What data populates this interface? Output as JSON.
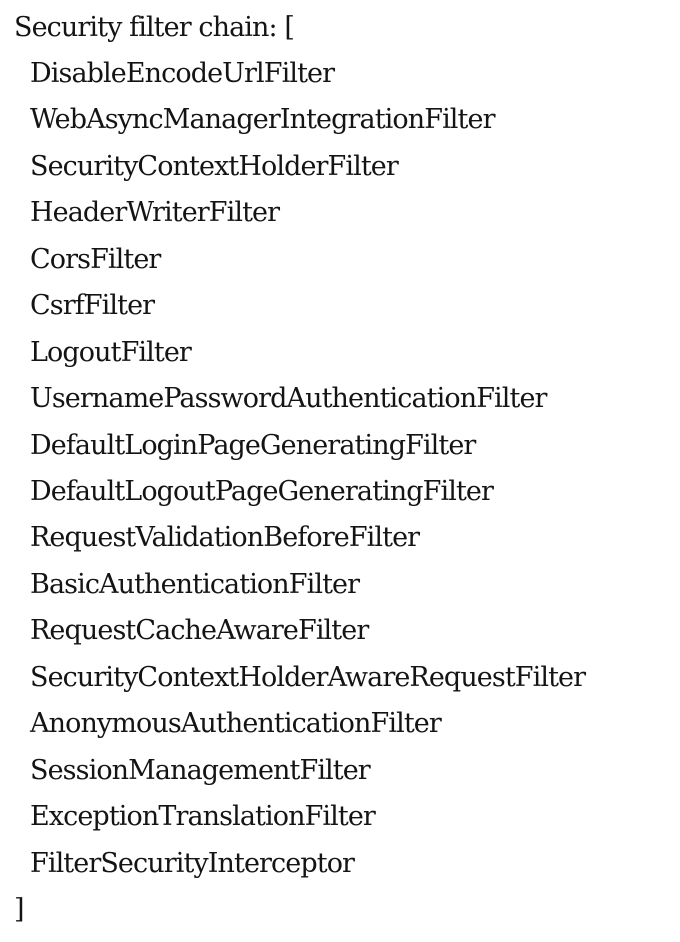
{
  "heading": "Security filter chain: [",
  "filters": [
    "DisableEncodeUrlFilter",
    "WebAsyncManagerIntegrationFilter",
    "SecurityContextHolderFilter",
    "HeaderWriterFilter",
    "CorsFilter",
    "CsrfFilter",
    "LogoutFilter",
    "UsernamePasswordAuthenticationFilter",
    "DefaultLoginPageGeneratingFilter",
    "DefaultLogoutPageGeneratingFilter",
    "RequestValidationBeforeFilter",
    "BasicAuthenticationFilter",
    "RequestCacheAwareFilter",
    "SecurityContextHolderAwareRequestFilter",
    "AnonymousAuthenticationFilter",
    "SessionManagementFilter",
    "ExceptionTranslationFilter",
    "FilterSecurityInterceptor"
  ],
  "closing": "]"
}
